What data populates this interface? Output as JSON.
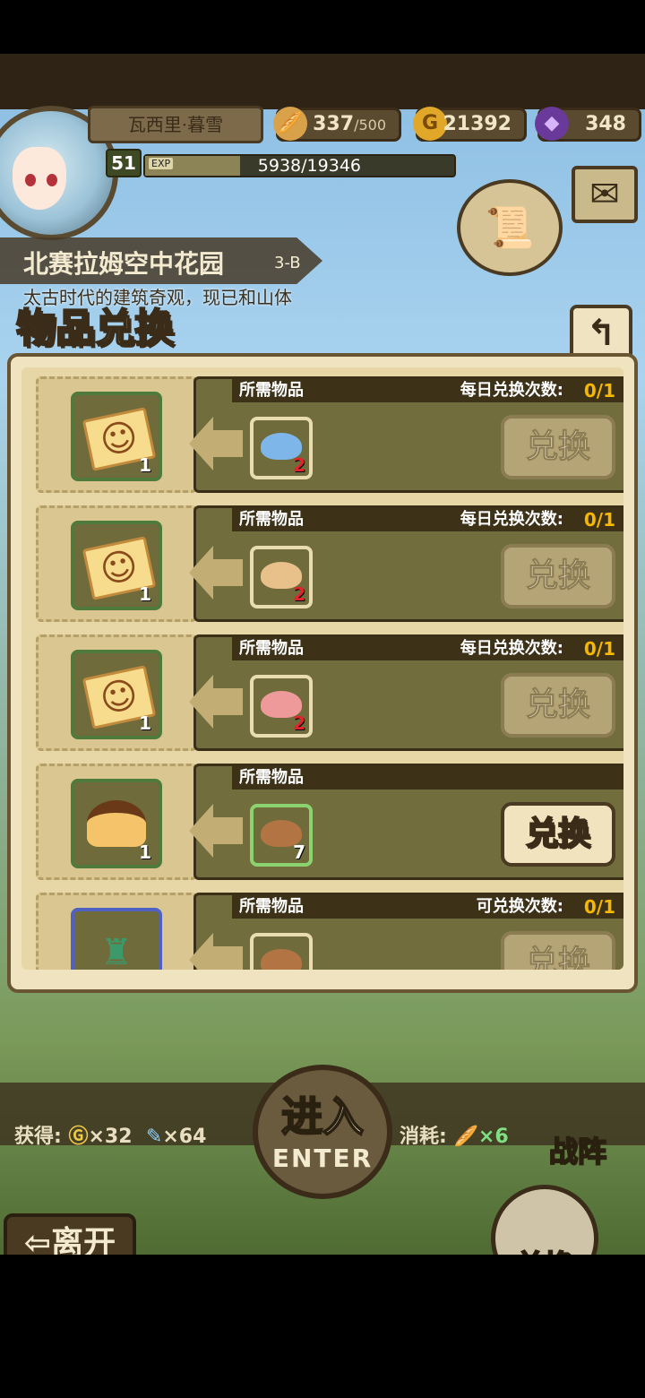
{
  "player": {
    "name": "瓦西里·暮雪",
    "level": "51",
    "exp_label": "EXP",
    "exp": "5938/19346",
    "exp_fraction": 0.307
  },
  "resources": {
    "stamina": "337",
    "stamina_max": "/500",
    "gold": "21392",
    "gems": "348"
  },
  "location": {
    "title": "北赛拉姆空中花园",
    "stage": "3-B",
    "description": "太古时代的建筑奇观，现已和山体"
  },
  "modal": {
    "title": "物品兑换",
    "back_icon": "↰",
    "rows": [
      {
        "required_label": "所需物品",
        "count_label": "每日兑换次数:",
        "count_value": "0/1",
        "reward_qty": "1",
        "reward_icon": "ticket",
        "req_qty": "2",
        "req_color": "#7fb6ea",
        "button": "兑换",
        "enabled": false
      },
      {
        "required_label": "所需物品",
        "count_label": "每日兑换次数:",
        "count_value": "0/1",
        "reward_qty": "1",
        "reward_icon": "ticket",
        "req_qty": "2",
        "req_color": "#e7c08a",
        "button": "兑换",
        "enabled": false
      },
      {
        "required_label": "所需物品",
        "count_label": "每日兑换次数:",
        "count_value": "0/1",
        "reward_qty": "1",
        "reward_icon": "ticket",
        "req_qty": "2",
        "req_color": "#ef9a9a",
        "button": "兑换",
        "enabled": false
      },
      {
        "required_label": "所需物品",
        "count_label": "",
        "count_value": "",
        "reward_qty": "1",
        "reward_icon": "pudding",
        "req_qty": "7",
        "req_color": "#b27443",
        "button": "兑换",
        "enabled": true
      },
      {
        "required_label": "所需物品",
        "count_label": "可兑换次数:",
        "count_value": "0/1",
        "reward_qty": "",
        "reward_icon": "statue",
        "req_qty": "",
        "req_color": "#b27443",
        "button": "兑换",
        "enabled": false
      }
    ]
  },
  "bottom": {
    "gain_label": "获得:",
    "gain_gold": "×32",
    "gain_feather": "×64",
    "consume_label": "消耗:",
    "consume_stamina": "×6",
    "enter_cn": "进入",
    "enter_en": "ENTER",
    "formation": "战阵",
    "leave": "离开",
    "exchange": "兑换"
  }
}
